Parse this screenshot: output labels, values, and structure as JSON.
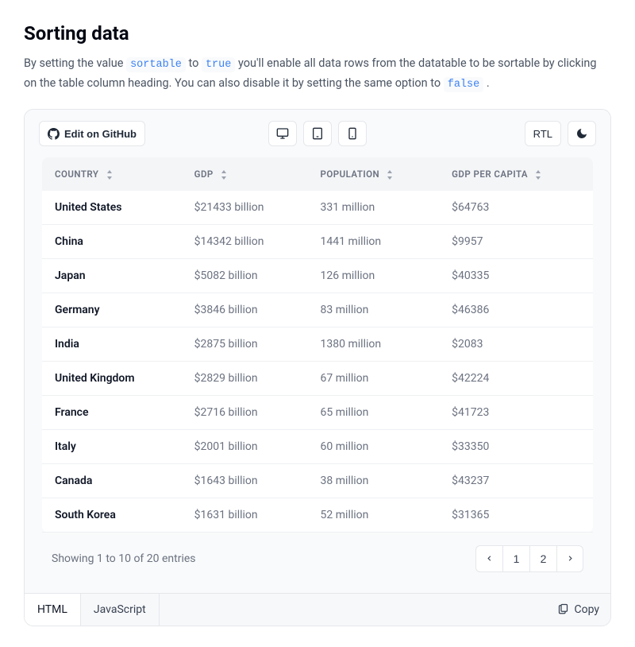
{
  "page": {
    "title": "Sorting data",
    "intro_before": "By setting the value ",
    "intro_code1": "sortable",
    "intro_mid1": " to ",
    "intro_code2": "true",
    "intro_mid2": " you'll enable all data rows from the datatable to be sortable by clicking on the table column heading. You can also disable it by setting the same option to ",
    "intro_code3": "false",
    "intro_after": "."
  },
  "toolbar": {
    "edit_label": "Edit on GitHub",
    "rtl_label": "RTL"
  },
  "table": {
    "headers": {
      "country": "COUNTRY",
      "gdp": "GDP",
      "population": "POPULATION",
      "gdp_per_capita": "GDP PER CAPITA"
    },
    "rows": [
      {
        "country": "United States",
        "gdp": "$21433 billion",
        "population": "331 million",
        "gpc": "$64763"
      },
      {
        "country": "China",
        "gdp": "$14342 billion",
        "population": "1441 million",
        "gpc": "$9957"
      },
      {
        "country": "Japan",
        "gdp": "$5082 billion",
        "population": "126 million",
        "gpc": "$40335"
      },
      {
        "country": "Germany",
        "gdp": "$3846 billion",
        "population": "83 million",
        "gpc": "$46386"
      },
      {
        "country": "India",
        "gdp": "$2875 billion",
        "population": "1380 million",
        "gpc": "$2083"
      },
      {
        "country": "United Kingdom",
        "gdp": "$2829 billion",
        "population": "67 million",
        "gpc": "$42224"
      },
      {
        "country": "France",
        "gdp": "$2716 billion",
        "population": "65 million",
        "gpc": "$41723"
      },
      {
        "country": "Italy",
        "gdp": "$2001 billion",
        "population": "60 million",
        "gpc": "$33350"
      },
      {
        "country": "Canada",
        "gdp": "$1643 billion",
        "population": "38 million",
        "gpc": "$43237"
      },
      {
        "country": "South Korea",
        "gdp": "$1631 billion",
        "population": "52 million",
        "gpc": "$31365"
      }
    ],
    "footer_text": "Showing 1 to 10 of 20 entries",
    "pages": [
      "1",
      "2"
    ]
  },
  "code_tabs": {
    "html": "HTML",
    "javascript": "JavaScript",
    "copy": "Copy"
  }
}
